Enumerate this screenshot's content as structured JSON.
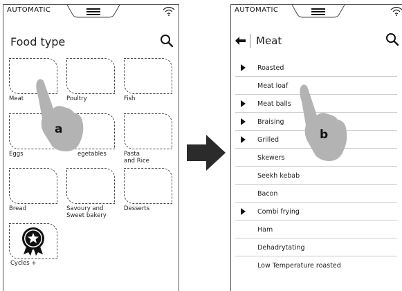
{
  "left_screen": {
    "status": {
      "mode": "AUTOMATIC"
    },
    "title": "Food type",
    "tiles": [
      {
        "label": "Meat"
      },
      {
        "label": "Poultry"
      },
      {
        "label": "Fish"
      },
      {
        "label": "Eggs"
      },
      {
        "label": "egetables"
      },
      {
        "label": "Pasta\nand Rice"
      },
      {
        "label": "Bread"
      },
      {
        "label": "Savoury and\nSweet bakery"
      },
      {
        "label": "Desserts"
      },
      {
        "label": "Cycles +"
      }
    ],
    "callout": "a"
  },
  "right_screen": {
    "status": {
      "mode": "AUTOMATIC"
    },
    "title": "Meat",
    "items": [
      {
        "label": "Roasted",
        "submenu": true
      },
      {
        "label": "Meat loaf",
        "submenu": false
      },
      {
        "label": "Meat balls",
        "submenu": true
      },
      {
        "label": "Braising",
        "submenu": true
      },
      {
        "label": "Grilled",
        "submenu": true
      },
      {
        "label": "Skewers",
        "submenu": false
      },
      {
        "label": "Seekh kebab",
        "submenu": false
      },
      {
        "label": "Bacon",
        "submenu": false
      },
      {
        "label": "Combi frying",
        "submenu": true
      },
      {
        "label": "Ham",
        "submenu": false
      },
      {
        "label": "Dehadrytating",
        "submenu": false
      },
      {
        "label": "Low Temperature roasted",
        "submenu": false
      }
    ],
    "callout": "b"
  },
  "colors": {
    "hand": "#b3b3b3",
    "arrow": "#2b2b2b",
    "border": "#555555"
  },
  "icons": [
    "menu-icon",
    "wifi-icon",
    "search-icon",
    "back-arrow-icon",
    "submenu-arrow-icon",
    "badge-star-icon",
    "hand-pointer-icon",
    "transition-arrow-icon"
  ]
}
